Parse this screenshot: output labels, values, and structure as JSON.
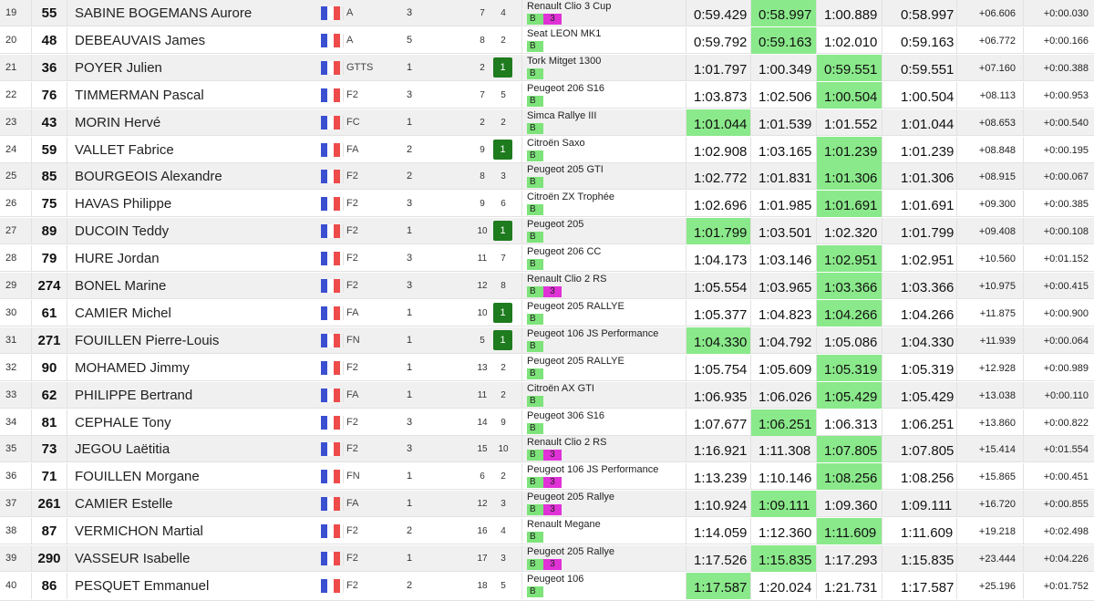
{
  "colors": {
    "best_time": "#8ae98a",
    "position_gain": "#1e7b1e",
    "badge_b": "#7de37a",
    "badge_3": "#e032d6"
  },
  "results": [
    {
      "pos": "19",
      "num": "55",
      "name": "SABINE BOGEMANS Aurore",
      "grp": "A",
      "cls": "3",
      "pg": "7",
      "pc": "4",
      "pc_gain": false,
      "car": "Renault Clio 3 Cup",
      "badge_b": "B",
      "badge_3": "3",
      "t1": "0:59.429",
      "t2": "0:58.997",
      "t3": "1:00.889",
      "best": "0:58.997",
      "gap": "+06.606",
      "diff": "+0:00.030",
      "best_col": "t2"
    },
    {
      "pos": "20",
      "num": "48",
      "name": "DEBEAUVAIS James",
      "grp": "A",
      "cls": "5",
      "pg": "8",
      "pc": "2",
      "pc_gain": false,
      "car": "Seat LEON MK1",
      "badge_b": "B",
      "badge_3": "",
      "t1": "0:59.792",
      "t2": "0:59.163",
      "t3": "1:02.010",
      "best": "0:59.163",
      "gap": "+06.772",
      "diff": "+0:00.166",
      "best_col": "t2"
    },
    {
      "pos": "21",
      "num": "36",
      "name": "POYER Julien",
      "grp": "GTTS",
      "cls": "1",
      "pg": "2",
      "pc": "1",
      "pc_gain": true,
      "car": "Tork Mitget 1300",
      "badge_b": "B",
      "badge_3": "",
      "t1": "1:01.797",
      "t2": "1:00.349",
      "t3": "0:59.551",
      "best": "0:59.551",
      "gap": "+07.160",
      "diff": "+0:00.388",
      "best_col": "t3"
    },
    {
      "pos": "22",
      "num": "76",
      "name": "TIMMERMAN Pascal",
      "grp": "F2",
      "cls": "3",
      "pg": "7",
      "pc": "5",
      "pc_gain": false,
      "car": "Peugeot 206 S16",
      "badge_b": "B",
      "badge_3": "",
      "t1": "1:03.873",
      "t2": "1:02.506",
      "t3": "1:00.504",
      "best": "1:00.504",
      "gap": "+08.113",
      "diff": "+0:00.953",
      "best_col": "t3"
    },
    {
      "pos": "23",
      "num": "43",
      "name": "MORIN Hervé",
      "grp": "FC",
      "cls": "1",
      "pg": "2",
      "pc": "2",
      "pc_gain": false,
      "car": "Simca Rallye III",
      "badge_b": "B",
      "badge_3": "",
      "t1": "1:01.044",
      "t2": "1:01.539",
      "t3": "1:01.552",
      "best": "1:01.044",
      "gap": "+08.653",
      "diff": "+0:00.540",
      "best_col": "t1"
    },
    {
      "pos": "24",
      "num": "59",
      "name": "VALLET Fabrice",
      "grp": "FA",
      "cls": "2",
      "pg": "9",
      "pc": "1",
      "pc_gain": true,
      "car": "Citroën Saxo",
      "badge_b": "B",
      "badge_3": "",
      "t1": "1:02.908",
      "t2": "1:03.165",
      "t3": "1:01.239",
      "best": "1:01.239",
      "gap": "+08.848",
      "diff": "+0:00.195",
      "best_col": "t3"
    },
    {
      "pos": "25",
      "num": "85",
      "name": "BOURGEOIS Alexandre",
      "grp": "F2",
      "cls": "2",
      "pg": "8",
      "pc": "3",
      "pc_gain": false,
      "car": "Peugeot 205 GTI",
      "badge_b": "B",
      "badge_3": "",
      "t1": "1:02.772",
      "t2": "1:01.831",
      "t3": "1:01.306",
      "best": "1:01.306",
      "gap": "+08.915",
      "diff": "+0:00.067",
      "best_col": "t3"
    },
    {
      "pos": "26",
      "num": "75",
      "name": "HAVAS Philippe",
      "grp": "F2",
      "cls": "3",
      "pg": "9",
      "pc": "6",
      "pc_gain": false,
      "car": "Citroën ZX Trophée",
      "badge_b": "B",
      "badge_3": "",
      "t1": "1:02.696",
      "t2": "1:01.985",
      "t3": "1:01.691",
      "best": "1:01.691",
      "gap": "+09.300",
      "diff": "+0:00.385",
      "best_col": "t3"
    },
    {
      "pos": "27",
      "num": "89",
      "name": "DUCOIN Teddy",
      "grp": "F2",
      "cls": "1",
      "pg": "10",
      "pc": "1",
      "pc_gain": true,
      "car": "Peugeot 205",
      "badge_b": "B",
      "badge_3": "",
      "t1": "1:01.799",
      "t2": "1:03.501",
      "t3": "1:02.320",
      "best": "1:01.799",
      "gap": "+09.408",
      "diff": "+0:00.108",
      "best_col": "t1"
    },
    {
      "pos": "28",
      "num": "79",
      "name": "HURE Jordan",
      "grp": "F2",
      "cls": "3",
      "pg": "11",
      "pc": "7",
      "pc_gain": false,
      "car": "Peugeot 206 CC",
      "badge_b": "B",
      "badge_3": "",
      "t1": "1:04.173",
      "t2": "1:03.146",
      "t3": "1:02.951",
      "best": "1:02.951",
      "gap": "+10.560",
      "diff": "+0:01.152",
      "best_col": "t3"
    },
    {
      "pos": "29",
      "num": "274",
      "name": "BONEL Marine",
      "grp": "F2",
      "cls": "3",
      "pg": "12",
      "pc": "8",
      "pc_gain": false,
      "car": "Renault Clio 2 RS",
      "badge_b": "B",
      "badge_3": "3",
      "t1": "1:05.554",
      "t2": "1:03.965",
      "t3": "1:03.366",
      "best": "1:03.366",
      "gap": "+10.975",
      "diff": "+0:00.415",
      "best_col": "t3"
    },
    {
      "pos": "30",
      "num": "61",
      "name": "CAMIER Michel",
      "grp": "FA",
      "cls": "1",
      "pg": "10",
      "pc": "1",
      "pc_gain": true,
      "car": "Peugeot 205 RALLYE",
      "badge_b": "B",
      "badge_3": "",
      "t1": "1:05.377",
      "t2": "1:04.823",
      "t3": "1:04.266",
      "best": "1:04.266",
      "gap": "+11.875",
      "diff": "+0:00.900",
      "best_col": "t3"
    },
    {
      "pos": "31",
      "num": "271",
      "name": "FOUILLEN Pierre-Louis",
      "grp": "FN",
      "cls": "1",
      "pg": "5",
      "pc": "1",
      "pc_gain": true,
      "car": "Peugeot 106 JS Performance",
      "badge_b": "B",
      "badge_3": "",
      "t1": "1:04.330",
      "t2": "1:04.792",
      "t3": "1:05.086",
      "best": "1:04.330",
      "gap": "+11.939",
      "diff": "+0:00.064",
      "best_col": "t1"
    },
    {
      "pos": "32",
      "num": "90",
      "name": "MOHAMED Jimmy",
      "grp": "F2",
      "cls": "1",
      "pg": "13",
      "pc": "2",
      "pc_gain": false,
      "car": "Peugeot 205 RALLYE",
      "badge_b": "B",
      "badge_3": "",
      "t1": "1:05.754",
      "t2": "1:05.609",
      "t3": "1:05.319",
      "best": "1:05.319",
      "gap": "+12.928",
      "diff": "+0:00.989",
      "best_col": "t3"
    },
    {
      "pos": "33",
      "num": "62",
      "name": "PHILIPPE Bertrand",
      "grp": "FA",
      "cls": "1",
      "pg": "11",
      "pc": "2",
      "pc_gain": false,
      "car": "Citroën AX GTI",
      "badge_b": "B",
      "badge_3": "",
      "t1": "1:06.935",
      "t2": "1:06.026",
      "t3": "1:05.429",
      "best": "1:05.429",
      "gap": "+13.038",
      "diff": "+0:00.110",
      "best_col": "t3"
    },
    {
      "pos": "34",
      "num": "81",
      "name": "CEPHALE Tony",
      "grp": "F2",
      "cls": "3",
      "pg": "14",
      "pc": "9",
      "pc_gain": false,
      "car": "Peugeot 306 S16",
      "badge_b": "B",
      "badge_3": "",
      "t1": "1:07.677",
      "t2": "1:06.251",
      "t3": "1:06.313",
      "best": "1:06.251",
      "gap": "+13.860",
      "diff": "+0:00.822",
      "best_col": "t2"
    },
    {
      "pos": "35",
      "num": "73",
      "name": "JEGOU Laëtitia",
      "grp": "F2",
      "cls": "3",
      "pg": "15",
      "pc": "10",
      "pc_gain": false,
      "car": "Renault Clio 2 RS",
      "badge_b": "B",
      "badge_3": "3",
      "t1": "1:16.921",
      "t2": "1:11.308",
      "t3": "1:07.805",
      "best": "1:07.805",
      "gap": "+15.414",
      "diff": "+0:01.554",
      "best_col": "t3"
    },
    {
      "pos": "36",
      "num": "71",
      "name": "FOUILLEN Morgane",
      "grp": "FN",
      "cls": "1",
      "pg": "6",
      "pc": "2",
      "pc_gain": false,
      "car": "Peugeot 106 JS Performance",
      "badge_b": "B",
      "badge_3": "3",
      "t1": "1:13.239",
      "t2": "1:10.146",
      "t3": "1:08.256",
      "best": "1:08.256",
      "gap": "+15.865",
      "diff": "+0:00.451",
      "best_col": "t3"
    },
    {
      "pos": "37",
      "num": "261",
      "name": "CAMIER Estelle",
      "grp": "FA",
      "cls": "1",
      "pg": "12",
      "pc": "3",
      "pc_gain": false,
      "car": "Peugeot 205 Rallye",
      "badge_b": "B",
      "badge_3": "3",
      "t1": "1:10.924",
      "t2": "1:09.111",
      "t3": "1:09.360",
      "best": "1:09.111",
      "gap": "+16.720",
      "diff": "+0:00.855",
      "best_col": "t2"
    },
    {
      "pos": "38",
      "num": "87",
      "name": "VERMICHON Martial",
      "grp": "F2",
      "cls": "2",
      "pg": "16",
      "pc": "4",
      "pc_gain": false,
      "car": "Renault Megane",
      "badge_b": "B",
      "badge_3": "",
      "t1": "1:14.059",
      "t2": "1:12.360",
      "t3": "1:11.609",
      "best": "1:11.609",
      "gap": "+19.218",
      "diff": "+0:02.498",
      "best_col": "t3"
    },
    {
      "pos": "39",
      "num": "290",
      "name": "VASSEUR Isabelle",
      "grp": "F2",
      "cls": "1",
      "pg": "17",
      "pc": "3",
      "pc_gain": false,
      "car": "Peugeot 205 Rallye",
      "badge_b": "B",
      "badge_3": "3",
      "t1": "1:17.526",
      "t2": "1:15.835",
      "t3": "1:17.293",
      "best": "1:15.835",
      "gap": "+23.444",
      "diff": "+0:04.226",
      "best_col": "t2"
    },
    {
      "pos": "40",
      "num": "86",
      "name": "PESQUET Emmanuel",
      "grp": "F2",
      "cls": "2",
      "pg": "18",
      "pc": "5",
      "pc_gain": false,
      "car": "Peugeot 106",
      "badge_b": "B",
      "badge_3": "",
      "t1": "1:17.587",
      "t2": "1:20.024",
      "t3": "1:21.731",
      "best": "1:17.587",
      "gap": "+25.196",
      "diff": "+0:01.752",
      "best_col": "t1"
    }
  ]
}
